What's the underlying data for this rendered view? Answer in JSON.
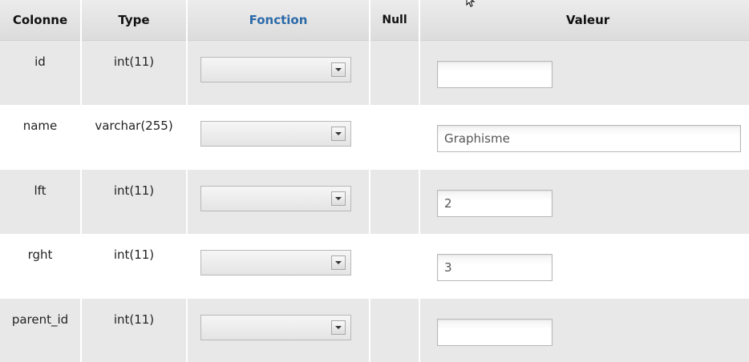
{
  "headers": {
    "colonne": "Colonne",
    "type": "Type",
    "fonction": "Fonction",
    "null": "Null",
    "valeur": "Valeur"
  },
  "rows": [
    {
      "colonne": "id",
      "type": "int(11)",
      "fonction": "",
      "valeur": ""
    },
    {
      "colonne": "name",
      "type": "varchar(255)",
      "fonction": "",
      "valeur": "Graphisme"
    },
    {
      "colonne": "lft",
      "type": "int(11)",
      "fonction": "",
      "valeur": "2"
    },
    {
      "colonne": "rght",
      "type": "int(11)",
      "fonction": "",
      "valeur": "3"
    },
    {
      "colonne": "parent_id",
      "type": "int(11)",
      "fonction": "",
      "valeur": ""
    }
  ],
  "icons": {
    "dropdown": "chevron-down-icon",
    "cursor": "mouse-pointer-icon"
  },
  "colors": {
    "header_bg": "#e2e2e2",
    "row_odd_bg": "#e8e8e8",
    "row_even_bg": "#ffffff",
    "link": "#2a6aa8"
  }
}
